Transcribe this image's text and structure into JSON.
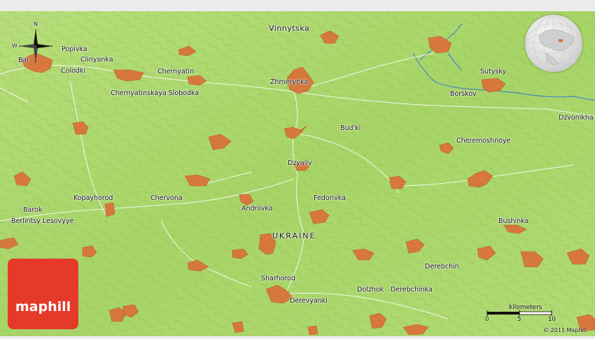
{
  "map": {
    "region_label": "UKRAINE",
    "places": [
      {
        "name": "Vinnytska"
      },
      {
        "name": "Zhmerynka"
      },
      {
        "name": "Popivka"
      },
      {
        "name": "Clinyanka"
      },
      {
        "name": "Colodki"
      },
      {
        "name": "Bar"
      },
      {
        "name": "Chernyatin"
      },
      {
        "name": "Chernyatinskaya Slobodka"
      },
      {
        "name": "Sutysky"
      },
      {
        "name": "Borskov"
      },
      {
        "name": "Dzvonikha"
      },
      {
        "name": "Bud'ki"
      },
      {
        "name": "Cheremoshnoye"
      },
      {
        "name": "Dzyaliv"
      },
      {
        "name": "Fedorivka"
      },
      {
        "name": "Kopayhorod"
      },
      {
        "name": "Chervona"
      },
      {
        "name": "Andriivka"
      },
      {
        "name": "Barok"
      },
      {
        "name": "Berlintsy Lesovyye"
      },
      {
        "name": "Bushinka"
      },
      {
        "name": "Derebchin"
      },
      {
        "name": "Sharhorod"
      },
      {
        "name": "Derevyanki"
      },
      {
        "name": "Dolzhok"
      },
      {
        "name": "Derebchinka"
      }
    ],
    "compass_letters": {
      "north": "N",
      "west": "W"
    },
    "colors": {
      "terrain": "#a9d66a",
      "settlement": "#d9733a",
      "river": "#4a86c5",
      "road": "#ffffff"
    }
  },
  "scale_bar": {
    "title": "kilometers",
    "ticks": [
      "0",
      "5",
      "10"
    ]
  },
  "copyright": "© 2011 Maphill",
  "logo": {
    "text": "maphill"
  },
  "overview_globe": {
    "icon": "globe-locator-icon"
  }
}
